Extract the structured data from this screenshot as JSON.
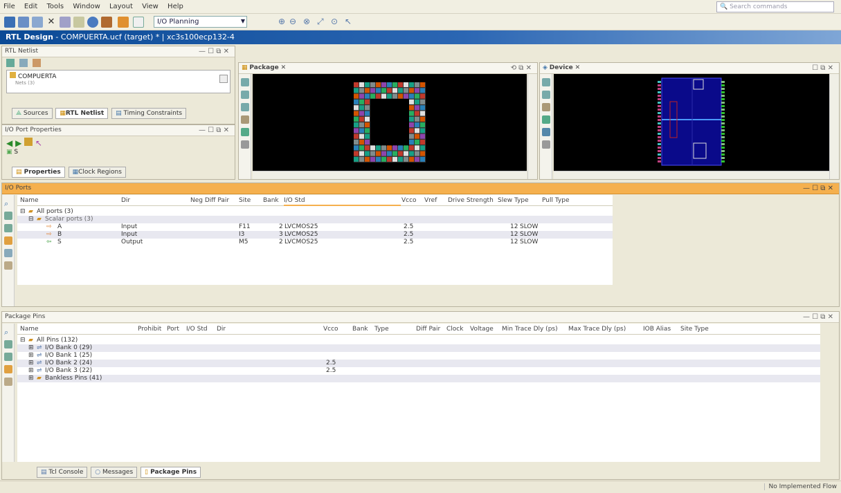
{
  "menu": [
    "File",
    "Edit",
    "Tools",
    "Window",
    "Layout",
    "View",
    "Help"
  ],
  "search_placeholder": "Search commands",
  "toolbar": {
    "combo_value": "I/O Planning"
  },
  "window_title": {
    "bold": "RTL Design",
    "rest": " - COMPUERTA.ucf (target) * | xc3s100ecp132-4"
  },
  "rtl_netlist": {
    "title": "RTL Netlist",
    "tree_root": "COMPUERTA",
    "tree_child": "Nets (3)",
    "tabs": [
      "Sources",
      "RTL Netlist",
      "Timing Constraints"
    ]
  },
  "io_port_props": {
    "title": "I/O Port Properties",
    "item": "S",
    "tabs": [
      "Properties",
      "Clock Regions"
    ]
  },
  "package_view": {
    "title": "Package"
  },
  "device_view": {
    "title": "Device"
  },
  "io_ports": {
    "title": "I/O Ports",
    "columns": [
      "Name",
      "Dir",
      "Neg Diff Pair",
      "Site",
      "Bank",
      "I/O Std",
      "Vcco",
      "Vref",
      "Drive Strength",
      "Slew Type",
      "Pull Type"
    ],
    "all_ports": "All ports (3)",
    "scalar_ports": "Scalar ports (3)",
    "rows": [
      {
        "name": "A",
        "dir": "Input",
        "site": "F11",
        "bank": "2",
        "iostd": "LVCMOS25",
        "vcco": "2.5",
        "drive": "12",
        "slew": "SLOW"
      },
      {
        "name": "B",
        "dir": "Input",
        "site": "I3",
        "bank": "3",
        "iostd": "LVCMOS25",
        "vcco": "2.5",
        "drive": "12",
        "slew": "SLOW"
      },
      {
        "name": "S",
        "dir": "Output",
        "site": "M5",
        "bank": "2",
        "iostd": "LVCMOS25",
        "vcco": "2.5",
        "drive": "12",
        "slew": "SLOW"
      }
    ]
  },
  "package_pins": {
    "title": "Package Pins",
    "columns": [
      "Name",
      "Prohibit",
      "Port",
      "I/O Std",
      "Dir",
      "Vcco",
      "Bank",
      "Type",
      "Diff Pair",
      "Clock",
      "Voltage",
      "Min Trace Dly (ps)",
      "Max Trace Dly (ps)",
      "IOB Alias",
      "Site Type"
    ],
    "all_pins": "All Pins (132)",
    "banks": [
      {
        "label": "I/O Bank 0 (29)",
        "vcco": ""
      },
      {
        "label": "I/O Bank 1 (25)",
        "vcco": ""
      },
      {
        "label": "I/O Bank 2 (24)",
        "vcco": "2.5"
      },
      {
        "label": "I/O Bank 3 (22)",
        "vcco": "2.5"
      }
    ],
    "bankless": "Bankless Pins (41)"
  },
  "bottom_tabs": [
    "Tcl Console",
    "Messages",
    "Package Pins"
  ],
  "status_right": "No Implemented Flow"
}
